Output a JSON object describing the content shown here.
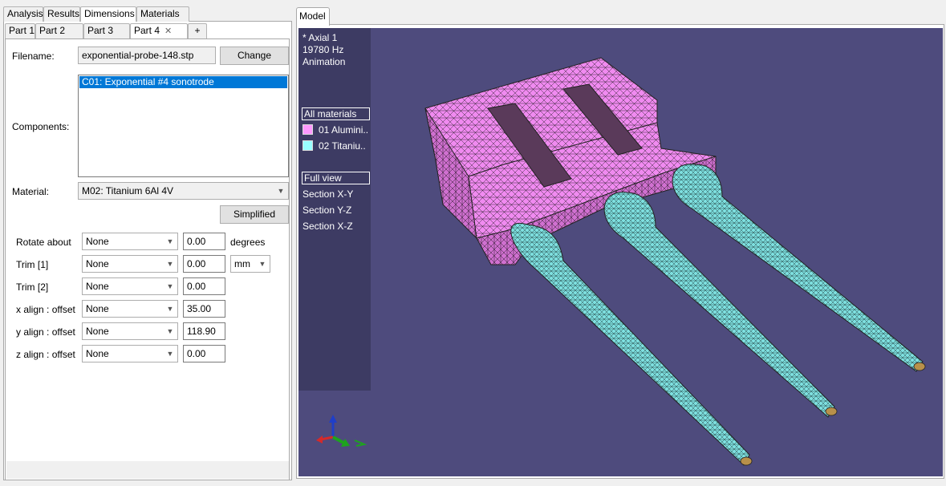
{
  "main_tabs": [
    "Analysis",
    "Results",
    "Dimensions",
    "Materials"
  ],
  "part_tabs": [
    "Part 1",
    "Part 2",
    "Part 3",
    "Part 4",
    "+"
  ],
  "part_close_icon": "close-icon",
  "form": {
    "filename_label": "Filename:",
    "filename_value": "exponential-probe-148.stp",
    "change_button": "Change",
    "components_label": "Components:",
    "components": [
      "C01: Exponential #4 sonotrode"
    ],
    "material_label": "Material:",
    "material_value": "M02: Titanium 6Al 4V",
    "simplified_button": "Simplified"
  },
  "transforms": [
    {
      "label": "Rotate about",
      "select": "None",
      "value": "0.00",
      "unit": "degrees"
    },
    {
      "label": "Trim [1]",
      "select": "None",
      "value": "0.00",
      "unit_select": "mm"
    },
    {
      "label": "Trim [2]",
      "select": "None",
      "value": "0.00"
    },
    {
      "label": "x align : offset",
      "select": "None",
      "value": "35.00"
    },
    {
      "label": "y align : offset",
      "select": "None",
      "value": "118.90"
    },
    {
      "label": "z align : offset",
      "select": "None",
      "value": "0.00"
    }
  ],
  "model": {
    "tab_label": "Model",
    "mode_line1": "* Axial 1",
    "mode_line2": "19780 Hz",
    "mode_line3": "Animation",
    "materials_header": "All materials",
    "materials": [
      {
        "label": "01 Alumini..",
        "color": "#ff99ff"
      },
      {
        "label": "02 Titaniu..",
        "color": "#99ffff"
      }
    ],
    "view_header": "Full view",
    "views": [
      "Section X-Y",
      "Section Y-Z",
      "Section X-Z"
    ]
  },
  "colors": {
    "viewport_bg": "#4e4b7d",
    "overlay_bg": "#3d3b63",
    "aluminium": "#f08af0",
    "titanium": "#7ee0e0",
    "selection": "#0078d7"
  }
}
